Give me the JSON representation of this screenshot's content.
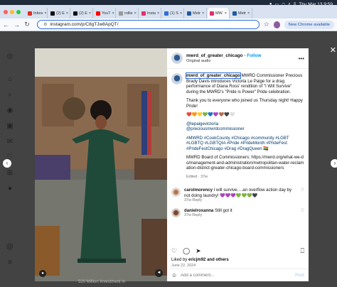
{
  "system": {
    "clock": "Thu Mar 13 9:59",
    "status_icons": [
      "record-icon",
      "battery-icon",
      "wifi-icon",
      "search-icon",
      "control-center-icon"
    ]
  },
  "browser": {
    "tabs": [
      {
        "label": "Inbox",
        "color": "#d93025"
      },
      {
        "label": "(2) E",
        "color": "#111111"
      },
      {
        "label": "(2) E",
        "color": "#111111"
      },
      {
        "label": "YouT",
        "color": "#ff0000"
      },
      {
        "label": "rollie",
        "color": "#999999"
      },
      {
        "label": "Insta",
        "color": "#e1306c"
      },
      {
        "label": "(1) S",
        "color": "#2f6fd6"
      },
      {
        "label": "Metr",
        "color": "#1f5aa0"
      },
      {
        "label": "MW",
        "color": "#e1306c"
      },
      {
        "label": "Metr",
        "color": "#1f5aa0"
      }
    ],
    "url": "instagram.com/p/C8gTJw8ApQT/",
    "new_chrome_label": "New Chrome available"
  },
  "instagram": {
    "post": {
      "username": "mwrd_of_greater_chicago",
      "follow_label": "Follow",
      "subtitle": "Original audio",
      "caption_intro": "MWRD Commissioner Precious Brady Davis introduces Victoria Le Paige for a drag performance of Diana Ross' rendition of \"I Will Survive\" during the MWRD's \"Pride is Power\" Pride celebration.",
      "caption_thanks": "Thank you to everyone who joined us Thursday night! Happy Pride!",
      "caption_emojis": "❤️🧡💛💚💙💜🤎🖤🤍",
      "mention_1": "@lepaigevictoria",
      "mention_2": "@preciousmwrdcommissioner",
      "hashtags": "#MWRD #CookCounty #Chicago #community #LGBT #LGBTQ #LGBTQIA #Pride #PrideMonth #PrideFest #PrideFestChicago #Drag #DragQueen 🏳️‍🌈",
      "board_text": "MWRD Board of Commissioners: https://mwrd.org/what-we-do/management-and-administration/metropolitan-water-reclamation-district-greater-chicago-board-commissioners",
      "caption_meta": "Edited · 37w",
      "comments": [
        {
          "user": "carolmorency",
          "text": "I will survive….an overflow action day by not doing laundry! 💜💜💜💚💚💚🖤",
          "meta": "37w   Reply"
        },
        {
          "user": "danielroxanna",
          "text": "Still got it",
          "meta": "37w   Reply"
        }
      ],
      "liked_by_prefix": "Liked by",
      "liked_by_user": "ericjm92",
      "liked_by_suffix": "and others",
      "date": "June 22, 2024",
      "add_comment_placeholder": "Add a comment...",
      "post_label": "Post"
    },
    "background_text": "520 Million Investment in"
  }
}
